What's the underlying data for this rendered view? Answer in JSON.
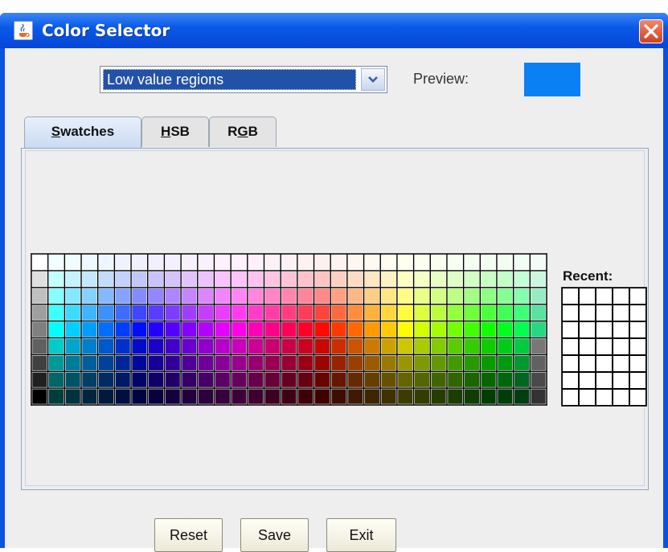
{
  "window": {
    "title": "Color Selector"
  },
  "toolbar": {
    "region_select": {
      "value": "Low value regions"
    },
    "preview_label": "Preview:",
    "preview_color": "#0a80f5"
  },
  "tabs": [
    {
      "label": "Swatches",
      "mnemonic": "S",
      "rest": "watches",
      "active": true
    },
    {
      "label": "HSB",
      "mnemonic": "H",
      "rest": "SB",
      "active": false
    },
    {
      "label": "RGB",
      "prefix": "R",
      "mnemonic": "G",
      "rest": "B",
      "active": false
    }
  ],
  "swatches": {
    "columns": 31,
    "rows": 9
  },
  "recent": {
    "label": "Recent:",
    "columns": 5,
    "rows": 7,
    "color": "#ffffff"
  },
  "buttons": {
    "reset": "Reset",
    "save": "Save",
    "exit": "Exit"
  },
  "icons": {
    "app": "java-cup-icon",
    "close": "close-icon",
    "dropdown": "chevron-down-icon"
  }
}
